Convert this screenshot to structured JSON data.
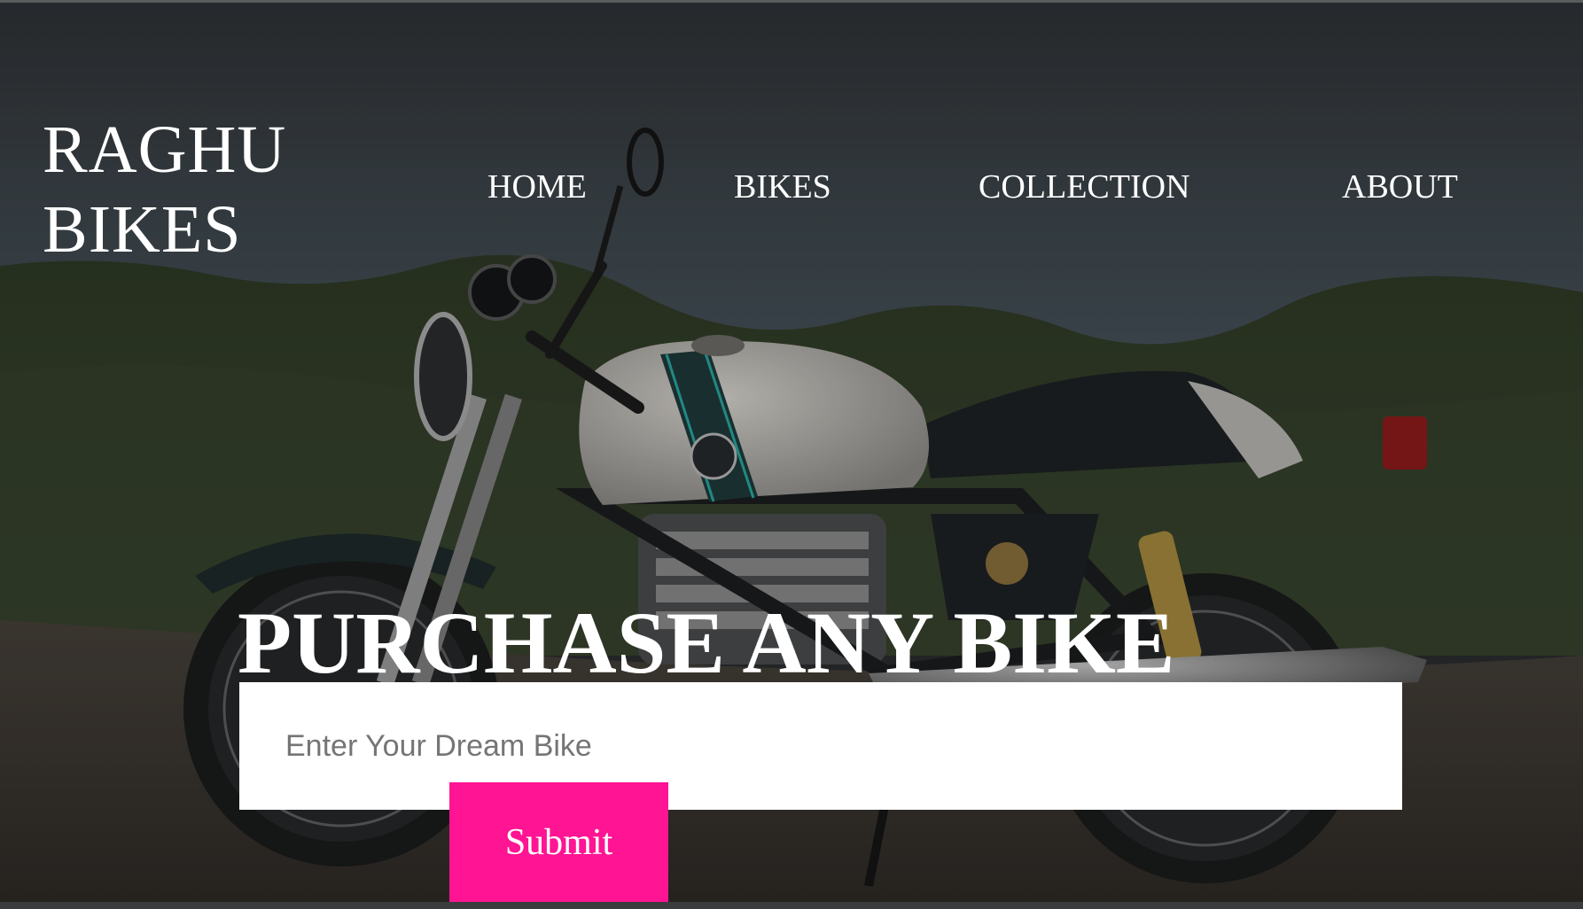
{
  "brand": {
    "line1": "RAGHU",
    "line2": "BIKES"
  },
  "nav": {
    "items": [
      {
        "label": "HOME"
      },
      {
        "label": "BIKES"
      },
      {
        "label": "COLLECTION"
      },
      {
        "label": "ABOUT"
      }
    ]
  },
  "hero": {
    "headline": "PURCHASE ANY BIKE",
    "input_placeholder": "Enter Your Dream Bike",
    "input_value": "",
    "submit_label": "Submit"
  },
  "colors": {
    "text": "#ffffff",
    "accent": "#ff1493",
    "input_bg": "#ffffff"
  }
}
